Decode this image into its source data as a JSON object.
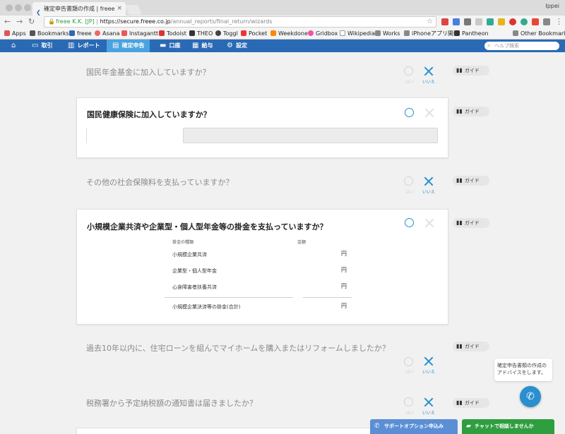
{
  "browser": {
    "tab_title": "確定申告書類の作成 | freee",
    "close_glyph": "×",
    "user": "Ippei",
    "url_security": "freee K.K. [JP]",
    "url_sep": " | ",
    "url_host": "https://secure.freee.co.jp",
    "url_path": "/annual_reports/final_return/wizards",
    "bookmarks": [
      "Apps",
      "Bookmarks",
      "freee",
      "Asana",
      "Instagantt",
      "Todoist",
      "THEO",
      "Toggl",
      "Pocket",
      "Weekdone",
      "Gridbox",
      "Wikipedia",
      "Works",
      "iPhoneアプリ開発",
      "Pantheon",
      "Other Bookmarks"
    ]
  },
  "nav": {
    "items": [
      "取引",
      "レポート",
      "確定申告",
      "口座",
      "給与",
      "設定"
    ],
    "active": "確定申告",
    "search_placeholder": "ヘルプ検索"
  },
  "answer_labels": {
    "yes": "はい",
    "no": "いいえ"
  },
  "guide_label": "ガイド",
  "questions": [
    {
      "text": "国民年金基金に加入していますか？",
      "answer": "no"
    },
    {
      "text": "国民健康保険に加入していますか？",
      "answer": "yes"
    },
    {
      "text": "その他の社会保険料を支払っていますか？",
      "answer": "no"
    },
    {
      "text": "小規模企業共済や企業型・個人型年金等の掛金を支払っていますか？",
      "answer": "yes"
    },
    {
      "text": "過去10年以内に、住宅ローンを組んでマイホームを購入またはリフォームしましたか？",
      "answer": "no"
    },
    {
      "text": "税務署から予定納税額の通知書は届きましたか？",
      "answer": "no"
    }
  ],
  "pension_table": {
    "headers": [
      "掛金の種類",
      "金額"
    ],
    "rows": [
      {
        "label": "小規模企業共済",
        "unit": "円"
      },
      {
        "label": "企業型・個人型年金",
        "unit": "円"
      },
      {
        "label": "心身障害者扶養共済",
        "unit": "円"
      }
    ],
    "total": {
      "label": "小規模企業決済等の掛金(合計)",
      "unit": "円"
    }
  },
  "chat": {
    "bubble_text": "確定申告書類の作成のアドバイスをします。",
    "support_button": "サポートオプション申込み",
    "chat_button": "チャットで相談しませんか"
  },
  "colors": {
    "brand": "#2a6ab5",
    "accent": "#2a8fcf",
    "chat": "#2f9e3f"
  }
}
